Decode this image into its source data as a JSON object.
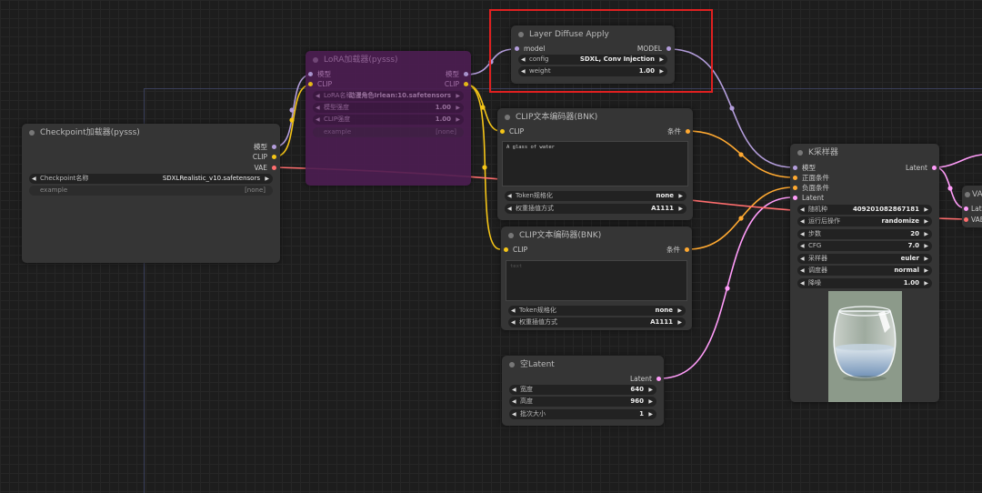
{
  "colors": {
    "model": "#b39ddb",
    "clip": "#f5c518",
    "vae": "#ff6e6e",
    "conditioning": "#ffa931",
    "latent": "#ff9cf9"
  },
  "icons": {
    "arrow_left": "◀",
    "arrow_right": "▶"
  },
  "layer_diffuse": {
    "title": "Layer Diffuse Apply",
    "in_model": "model",
    "out_model": "MODEL",
    "w_config_label": "config",
    "w_config_value": "SDXL, Conv Injection",
    "w_weight_label": "weight",
    "w_weight_value": "1.00"
  },
  "lora": {
    "title": "LoRA加载器(pysss)",
    "in_model": "模型",
    "in_clip": "CLIP",
    "out_model": "模型",
    "out_clip": "CLIP",
    "w1_label": "LoRA名称",
    "w1_value": "动漫角色Irlean:10.safetensors",
    "w2_label": "模型强度",
    "w2_value": "1.00",
    "w3_label": "CLIP强度",
    "w3_value": "1.00",
    "w4_label": "example",
    "w4_value": "[none]"
  },
  "checkpoint": {
    "title": "Checkpoint加载器(pysss)",
    "out_model": "模型",
    "out_clip": "CLIP",
    "out_vae": "VAE",
    "w1_label": "Checkpoint名称",
    "w1_value": "SDXLRealistic_v10.safetensors",
    "w2_label": "example",
    "w2_value": "[none]"
  },
  "clip_pos": {
    "title": "CLIP文本编码器(BNK)",
    "in_clip": "CLIP",
    "out": "条件",
    "text": "A glass of water",
    "w1_label": "Token规格化",
    "w1_value": "none",
    "w2_label": "权重插值方式",
    "w2_value": "A1111"
  },
  "clip_neg": {
    "title": "CLIP文本编码器(BNK)",
    "in_clip": "CLIP",
    "out": "条件",
    "text": "text",
    "w1_label": "Token规格化",
    "w1_value": "none",
    "w2_label": "权重插值方式",
    "w2_value": "A1111"
  },
  "empty_latent": {
    "title": "空Latent",
    "out": "Latent",
    "w1_label": "宽度",
    "w1_value": "640",
    "w2_label": "高度",
    "w2_value": "960",
    "w3_label": "批次大小",
    "w3_value": "1"
  },
  "ksampler": {
    "title": "K采样器",
    "in_model": "模型",
    "in_pos": "正面条件",
    "in_neg": "负面条件",
    "in_latent": "Latent",
    "out": "Latent",
    "w1_label": "随机种",
    "w1_value": "409201082867181",
    "w2_label": "运行后操作",
    "w2_value": "randomize",
    "w3_label": "步数",
    "w3_value": "20",
    "w4_label": "CFG",
    "w4_value": "7.0",
    "w5_label": "采样器",
    "w5_value": "euler",
    "w6_label": "调度器",
    "w6_value": "normal",
    "w7_label": "降噪",
    "w7_value": "1.00"
  },
  "vae_decode": {
    "title": "VA",
    "in_latent": "Latent",
    "in_vae": "VAE"
  }
}
